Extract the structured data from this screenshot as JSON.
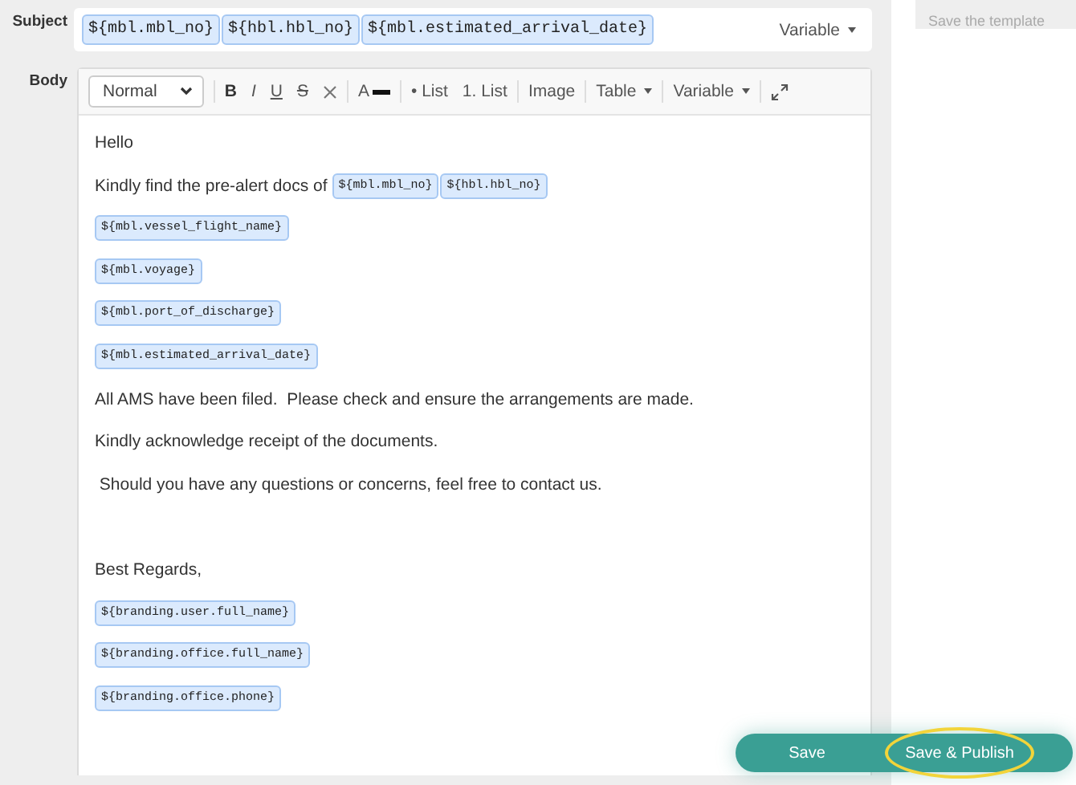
{
  "subject": {
    "label": "Subject",
    "chips": [
      "${mbl.mbl_no}",
      "${hbl.hbl_no}",
      "${mbl.estimated_arrival_date}"
    ],
    "variable_menu": "Variable"
  },
  "body": {
    "label": "Body",
    "toolbar": [
      [
        {
          "kind": "select",
          "label": "Normal"
        }
      ],
      [
        {
          "kind": "bold",
          "label": "B"
        },
        {
          "kind": "italic",
          "label": "I"
        },
        {
          "kind": "underline",
          "label": "U"
        },
        {
          "kind": "strike",
          "label": "S"
        },
        {
          "kind": "clear"
        }
      ],
      [
        {
          "kind": "color",
          "label": "A"
        }
      ],
      [
        {
          "kind": "text",
          "label": "• List"
        },
        {
          "kind": "text",
          "label": "1. List"
        }
      ],
      [
        {
          "kind": "text",
          "label": "Image"
        }
      ],
      [
        {
          "kind": "dropdown",
          "label": "Table"
        }
      ],
      [
        {
          "kind": "dropdown",
          "label": "Variable"
        }
      ],
      [
        {
          "kind": "expand"
        }
      ]
    ],
    "paragraphs": [
      {
        "kind": "line",
        "parts": [
          {
            "kind": "text",
            "text": "Hello"
          }
        ]
      },
      {
        "kind": "line",
        "parts": [
          {
            "kind": "text",
            "text": "Kindly find the pre-alert docs of"
          },
          {
            "kind": "chip",
            "text": "${mbl.mbl_no}"
          },
          {
            "kind": "chip",
            "text": "${hbl.hbl_no}"
          }
        ]
      },
      {
        "kind": "line",
        "parts": [
          {
            "kind": "chip",
            "text": "${mbl.vessel_flight_name}"
          }
        ]
      },
      {
        "kind": "line",
        "parts": [
          {
            "kind": "chip",
            "text": "${mbl.voyage}"
          }
        ]
      },
      {
        "kind": "line",
        "parts": [
          {
            "kind": "chip",
            "text": "${mbl.port_of_discharge}"
          }
        ]
      },
      {
        "kind": "line",
        "parts": [
          {
            "kind": "chip",
            "text": "${mbl.estimated_arrival_date}"
          }
        ]
      },
      {
        "kind": "line",
        "parts": [
          {
            "kind": "text",
            "text": "All AMS have been filed.  Please check and ensure the arrangements are made."
          }
        ]
      },
      {
        "kind": "line",
        "parts": [
          {
            "kind": "text",
            "text": "Kindly acknowledge receipt of the documents."
          }
        ]
      },
      {
        "kind": "line",
        "parts": [
          {
            "kind": "text",
            "text": " Should you have any questions or concerns, feel free to contact us."
          }
        ]
      },
      {
        "kind": "blank"
      },
      {
        "kind": "line",
        "parts": [
          {
            "kind": "text",
            "text": "Best Regards,"
          }
        ]
      },
      {
        "kind": "line",
        "parts": [
          {
            "kind": "chip",
            "text": "${branding.user.full_name}"
          }
        ]
      },
      {
        "kind": "line",
        "parts": [
          {
            "kind": "chip",
            "text": "${branding.office.full_name}"
          }
        ]
      },
      {
        "kind": "line",
        "parts": [
          {
            "kind": "chip",
            "text": "${branding.office.phone}"
          }
        ]
      }
    ]
  },
  "side_note": "Save the template",
  "actions": [
    {
      "label": "Save",
      "highlighted": false
    },
    {
      "label": "Save & Publish",
      "highlighted": true
    }
  ]
}
